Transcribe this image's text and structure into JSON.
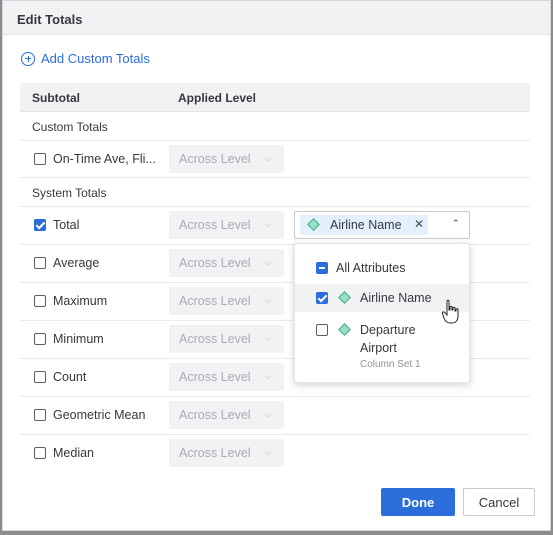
{
  "dialog": {
    "title": "Edit Totals",
    "add_custom_totals": "Add Custom Totals"
  },
  "table": {
    "col_subtotal": "Subtotal",
    "col_applied_level": "Applied Level"
  },
  "sections": {
    "custom": "Custom Totals",
    "system": "System Totals"
  },
  "rows": [
    {
      "label": "On-Time Ave, Fli...",
      "checked": false,
      "level": "Across Level"
    },
    {
      "label": "Total",
      "checked": true,
      "level": "Across Level"
    },
    {
      "label": "Average",
      "checked": false,
      "level": "Across Level"
    },
    {
      "label": "Maximum",
      "checked": false,
      "level": "Across Level"
    },
    {
      "label": "Minimum",
      "checked": false,
      "level": "Across Level"
    },
    {
      "label": "Count",
      "checked": false,
      "level": "Across Level"
    },
    {
      "label": "Geometric Mean",
      "checked": false,
      "level": "Across Level"
    },
    {
      "label": "Median",
      "checked": false,
      "level": "Across Level"
    }
  ],
  "attribute_select": {
    "chip_label": "Airline Name"
  },
  "dropdown": {
    "all_label": "All Attributes",
    "items": [
      {
        "label": "Airline Name",
        "checked": true
      },
      {
        "label": "Departure",
        "label2": "Airport",
        "sub": "Column Set 1",
        "checked": false
      }
    ]
  },
  "footer": {
    "done": "Done",
    "cancel": "Cancel"
  },
  "colors": {
    "accent": "#2a6ddb",
    "attribute_icon": "#34b08a"
  }
}
